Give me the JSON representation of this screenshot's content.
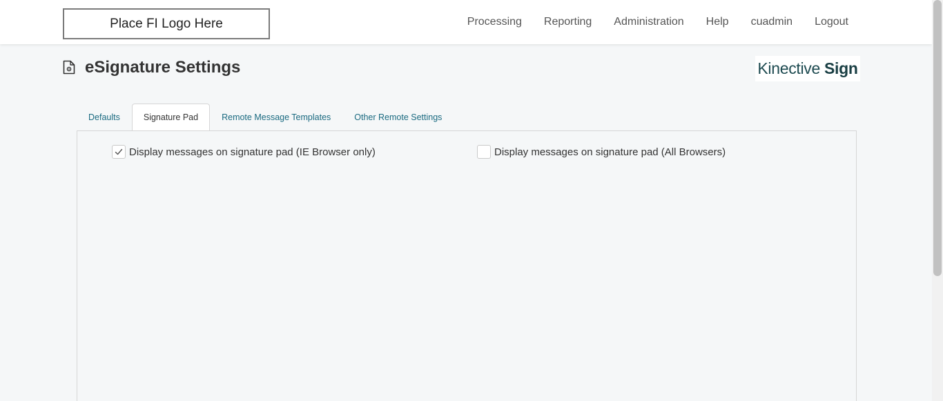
{
  "header": {
    "logo_text": "Place FI Logo Here",
    "nav": [
      "Processing",
      "Reporting",
      "Administration",
      "Help",
      "cuadmin",
      "Logout"
    ]
  },
  "page": {
    "icon": "settings-document-icon",
    "title": "eSignature Settings"
  },
  "brand": {
    "name_regular": "Kinective",
    "name_bold": "Sign"
  },
  "tabs": [
    {
      "label": "Defaults",
      "active": false
    },
    {
      "label": "Signature Pad",
      "active": true
    },
    {
      "label": "Remote Message Templates",
      "active": false
    },
    {
      "label": "Other Remote Settings",
      "active": false
    }
  ],
  "signature_pad": {
    "options": [
      {
        "label": "Display messages on signature pad (IE Browser only)",
        "checked": true
      },
      {
        "label": "Display messages on signature pad (All Browsers)",
        "checked": false
      }
    ]
  },
  "colors": {
    "tab_link": "#1a6a80",
    "brand": "#1e4b51",
    "background": "#f5f7f8"
  }
}
